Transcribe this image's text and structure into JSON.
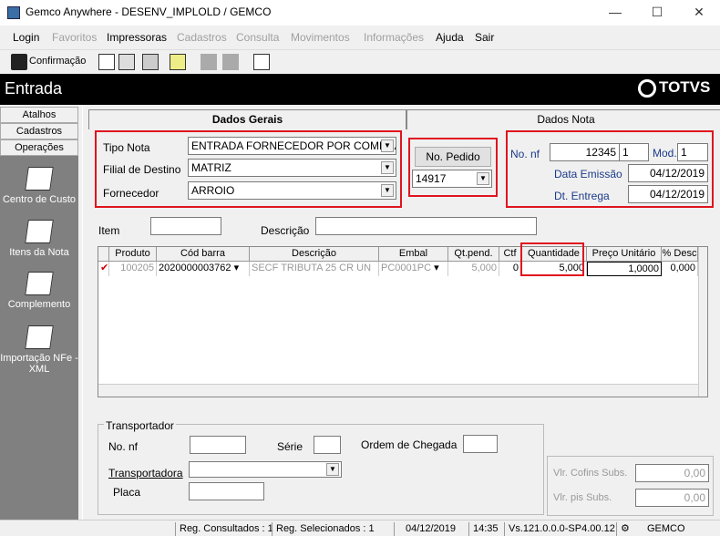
{
  "window": {
    "title": "Gemco Anywhere - DESENV_IMPLOLD / GEMCO",
    "minimize": "—",
    "maximize": "☐",
    "close": "✕"
  },
  "menu": [
    {
      "label": "Login",
      "enabled": true
    },
    {
      "label": "Favoritos",
      "enabled": false
    },
    {
      "label": "Impressoras",
      "enabled": true
    },
    {
      "label": "Cadastros",
      "enabled": false
    },
    {
      "label": "Consulta",
      "enabled": false
    },
    {
      "label": "Movimentos",
      "enabled": false
    },
    {
      "label": "Informações",
      "enabled": false
    },
    {
      "label": "Ajuda",
      "enabled": true
    },
    {
      "label": "Sair",
      "enabled": true
    }
  ],
  "toolbar": {
    "confirm_label": "Confirmação"
  },
  "header": {
    "title": "Entrada",
    "logo": "TOTVS"
  },
  "sidebar": {
    "tabs": [
      "Atalhos",
      "Cadastros",
      "Operações"
    ],
    "items": [
      "Centro de Custo",
      "Itens da Nota",
      "Complemento",
      "Importação NFe - XML"
    ]
  },
  "tabs": {
    "general": "Dados Gerais",
    "nota": "Dados Nota"
  },
  "form": {
    "tipo_nota_label": "Tipo Nota",
    "tipo_nota_value": "ENTRADA FORNECEDOR POR COMPRAS",
    "filial_label": "Filial de Destino",
    "filial_value": "MATRIZ",
    "fornecedor_label": "Fornecedor",
    "fornecedor_value": "ARROIO",
    "pedido_button": "No. Pedido",
    "pedido_value": "14917",
    "nf_label": "No. nf",
    "nf_value": "12345",
    "nf_serie": "1",
    "mod_label": "Mod.",
    "mod_value": "1",
    "emissao_label": "Data Emissão",
    "emissao_value": "04/12/2019",
    "entrega_label": "Dt. Entrega",
    "entrega_value": "04/12/2019",
    "item_label": "Item",
    "descricao_label": "Descrição"
  },
  "grid": {
    "columns": [
      "Produto",
      "Cód barra",
      "Descrição",
      "Embal",
      "Qt.pend.",
      "Ctf",
      "Quantidade",
      "Preço Unitário",
      "% Desc"
    ],
    "rows": [
      {
        "produto": "100205",
        "cod_barra": "2020000003762",
        "descricao": "SECF TRIBUTA 25  CR UN",
        "embal": "PC0001PC",
        "qt_pend": "5,000",
        "ctf": "0",
        "quantidade": "5,000",
        "preco": "1,0000",
        "desc": "0,000"
      }
    ]
  },
  "transport": {
    "group_label": "Transportador",
    "nf_label": "No. nf",
    "serie_label": "Série",
    "ordem_label": "Ordem de Chegada",
    "transportadora_label": "Transportadora",
    "placa_label": "Placa"
  },
  "totals": {
    "cofins_label": "Vlr. Cofins Subs.",
    "cofins_value": "0,00",
    "pis_label": "Vlr. pis Subs.",
    "pis_value": "0,00"
  },
  "status": {
    "consultados": "Reg. Consultados : 1",
    "selecionados": "Reg. Selecionados : 1",
    "date": "04/12/2019",
    "time": "14:35",
    "version": "Vs.121.0.0.0-SP4.00.12",
    "company": "GEMCO"
  }
}
